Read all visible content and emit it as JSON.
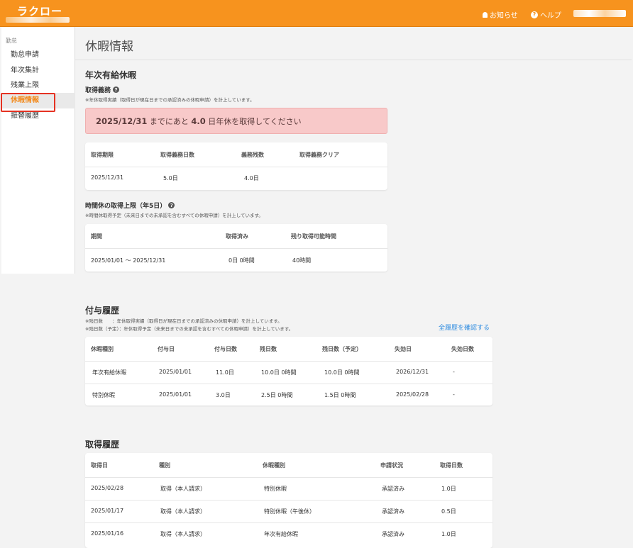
{
  "header": {
    "logo": "ラクロー",
    "notice_label": "お知らせ",
    "help_label": "ヘルプ"
  },
  "sidebar": {
    "section": "勤怠",
    "items": [
      {
        "label": "勤怠申請"
      },
      {
        "label": "年次集計"
      },
      {
        "label": "残業上限"
      },
      {
        "label": "休暇情報"
      },
      {
        "label": "振替履歴"
      }
    ]
  },
  "page": {
    "title": "休暇情報"
  },
  "annual": {
    "heading": "年次有給休暇",
    "obligation_title": "取得義務",
    "obligation_note": "※年休取得実績（取得日が現在日までの承認済みの休暇申請）を計上しています。",
    "alert": {
      "date": "2025/12/31",
      "mid": " までにあと ",
      "days": "4.0",
      "tail": " 日年休を取得してください"
    },
    "table": {
      "headers": [
        "取得期限",
        "取得義務日数",
        "義務残数",
        "取得義務クリア"
      ],
      "row": [
        "2025/12/31",
        "5.0日",
        "4.0日",
        ""
      ]
    },
    "hourly_title": "時間休の取得上限（年5日）",
    "hourly_note": "※時間休取得予定（未来日までの未承認を含むすべての休暇申請）を計上しています。",
    "hourly_table": {
      "headers": [
        "期間",
        "取得済み",
        "残り取得可能時間"
      ],
      "row": [
        "2025/01/01 〜 2025/12/31",
        "0日 0時間",
        "40時間"
      ]
    }
  },
  "grant": {
    "heading": "付与履歴",
    "note1": "※残日数　　：年休取得実績（取得日が現在日までの承認済みの休暇申請）を計上しています。",
    "note2": "※残日数（予定）：年休取得予定（未来日までの未承認を含むすべての休暇申請）を計上しています。",
    "link": "全履歴を確認する",
    "headers": [
      "休暇種別",
      "付与日",
      "付与日数",
      "残日数",
      "残日数（予定）",
      "失効日",
      "失効日数"
    ],
    "rows": [
      [
        "年次有給休暇",
        "2025/01/01",
        "11.0日",
        "10.0日 0時間",
        "10.0日 0時間",
        "2026/12/31",
        "-"
      ],
      [
        "特別休暇",
        "2025/01/01",
        "3.0日",
        "2.5日 0時間",
        "1.5日 0時間",
        "2025/02/28",
        "-"
      ]
    ]
  },
  "usage": {
    "heading": "取得履歴",
    "headers": [
      "取得日",
      "種別",
      "休暇種別",
      "申請状況",
      "取得日数"
    ],
    "rows": [
      [
        "2025/02/28",
        "取得（本人請求）",
        "特別休暇",
        "承認済み",
        "1.0日"
      ],
      [
        "2025/01/17",
        "取得（本人請求）",
        "特別休暇（午後休）",
        "承認済み",
        "0.5日"
      ],
      [
        "2025/01/16",
        "取得（本人請求）",
        "年次有給休暇",
        "承認済み",
        "1.0日"
      ]
    ]
  },
  "colors": {
    "brand": "#f7931e",
    "active": "#f28a1c",
    "alert_bg": "#f8c9c9",
    "link": "#2f8ce0",
    "highlight_border": "#e53222"
  }
}
